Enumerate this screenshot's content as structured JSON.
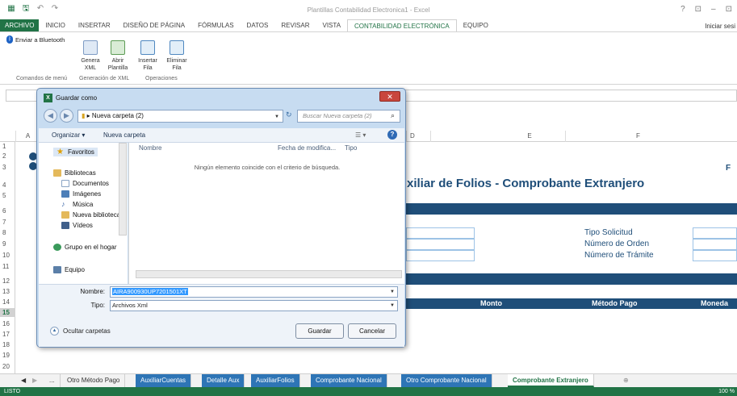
{
  "window": {
    "title": "Plantillas Contabilidad Electronica1 - Excel",
    "controls": [
      "?",
      "⊡",
      "–",
      "⊡",
      "✕"
    ]
  },
  "ribbon": {
    "tabs": [
      "ARCHIVO",
      "INICIO",
      "INSERTAR",
      "DISEÑO DE PÁGINA",
      "FÓRMULAS",
      "DATOS",
      "REVISAR",
      "VISTA",
      "CONTABILIDAD ELECTRÓNICA",
      "EQUIPO"
    ],
    "active_tab": "CONTABILIDAD ELECTRÓNICA",
    "signin": "Iniciar sesi",
    "bluetooth_label": "Enviar a Bluetooth",
    "buttons": [
      {
        "label1": "Genera",
        "label2": "XML"
      },
      {
        "label1": "Abrir",
        "label2": "Plantilla"
      },
      {
        "label1": "Insertar",
        "label2": "Fila"
      },
      {
        "label1": "Eliminar",
        "label2": "Fila"
      }
    ],
    "groups": [
      "Comandos de menú",
      "Generación de XML",
      "Operaciones"
    ]
  },
  "grid": {
    "columns": [
      "A",
      "D",
      "E",
      "F"
    ],
    "rows": [
      "1",
      "2",
      "3",
      "4",
      "5",
      "6",
      "7",
      "8",
      "9",
      "10",
      "11",
      "12",
      "13",
      "14",
      "15",
      "16",
      "17",
      "18",
      "19",
      "20"
    ],
    "selected_row": "15",
    "title": "xiliar de Folios - Comprobante Extranjero",
    "right_edge_letter": "F",
    "labels": [
      "Tipo Solicitud",
      "Número de Orden",
      "Número de Trámite"
    ],
    "headers": [
      "Monto",
      "Método Pago",
      "Moneda"
    ]
  },
  "sheets": [
    {
      "label": "Otro Método Pago",
      "style": "normal"
    },
    {
      "label": "AuxiliarCuentas",
      "style": "blue"
    },
    {
      "label": "Detalle Aux",
      "style": "blue"
    },
    {
      "label": "AuxiliarFolios",
      "style": "blue"
    },
    {
      "label": "Comprobante Nacional",
      "style": "blue"
    },
    {
      "label": "Otro Comprobante Nacional",
      "style": "blue"
    },
    {
      "label": "Comprobante Extranjero",
      "style": "active"
    }
  ],
  "sheet_nav": {
    "prev": "◀",
    "next": "▶",
    "more": "...",
    "add": "⊕"
  },
  "status": {
    "left": "LISTO",
    "zoom": "100 %"
  },
  "dialog": {
    "title": "Guardar como",
    "close": "✕",
    "path_folder": "Nueva carpeta (2)",
    "search_placeholder": "Buscar Nueva carpeta (2)",
    "toolbar": {
      "organize": "Organizar ▾",
      "new_folder": "Nueva carpeta",
      "help": "?"
    },
    "nav": {
      "favorites": "Favoritos",
      "libraries": "Bibliotecas",
      "items": [
        "Documentos",
        "Imágenes",
        "Música",
        "Nueva biblioteca",
        "Vídeos"
      ],
      "homegroup": "Grupo en el hogar",
      "computer": "Equipo"
    },
    "columns": [
      "Nombre",
      "Fecha de modifica...",
      "Tipo"
    ],
    "empty_message": "Ningún elemento coincide con el criterio de búsqueda.",
    "filename_label": "Nombre:",
    "filename_value": "AIRA900930UP7201501XT",
    "filetype_label": "Tipo:",
    "filetype_value": "Archivos Xml",
    "hide_folders": "Ocultar carpetas",
    "save": "Guardar",
    "cancel": "Cancelar"
  }
}
